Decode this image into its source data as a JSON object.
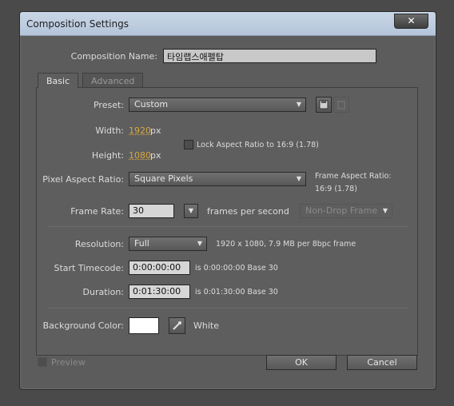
{
  "window": {
    "title": "Composition Settings",
    "close_glyph": "✕"
  },
  "composition_name": {
    "label": "Composition Name:",
    "value": "타임랩스애펠탑"
  },
  "tabs": [
    {
      "label": "Basic"
    },
    {
      "label": "Advanced"
    }
  ],
  "preset": {
    "label": "Preset:",
    "value": "Custom"
  },
  "width": {
    "label": "Width:",
    "value": "1920",
    "unit": "px"
  },
  "height": {
    "label": "Height:",
    "value": "1080",
    "unit": "px"
  },
  "lock_aspect": {
    "label": "Lock Aspect Ratio to 16:9 (1.78)",
    "checked": false
  },
  "pixel_aspect": {
    "label": "Pixel Aspect Ratio:",
    "value": "Square Pixels"
  },
  "frame_aspect": {
    "line1": "Frame Aspect Ratio:",
    "line2": "16:9 (1.78)"
  },
  "frame_rate": {
    "label": "Frame Rate:",
    "value": "30",
    "unit": "frames per second",
    "drop_frame": "Non-Drop Frame"
  },
  "resolution": {
    "label": "Resolution:",
    "value": "Full",
    "info": "1920 x 1080, 7.9 MB per 8bpc frame"
  },
  "start_timecode": {
    "label": "Start Timecode:",
    "value": "0:00:00:00",
    "info": "is 0:00:00:00  Base 30"
  },
  "duration": {
    "label": "Duration:",
    "value": "0:01:30:00",
    "info": "is 0:01:30:00  Base 30"
  },
  "background": {
    "label": "Background Color:",
    "color": "#ffffff",
    "name": "White"
  },
  "footer": {
    "preview_label": "Preview",
    "ok_label": "OK",
    "cancel_label": "Cancel"
  },
  "icons": {
    "save_preset": "save-preset-icon",
    "delete_preset": "trash-icon",
    "eyedropper": "eyedropper-icon",
    "dropdown": "chevron-down-icon"
  }
}
